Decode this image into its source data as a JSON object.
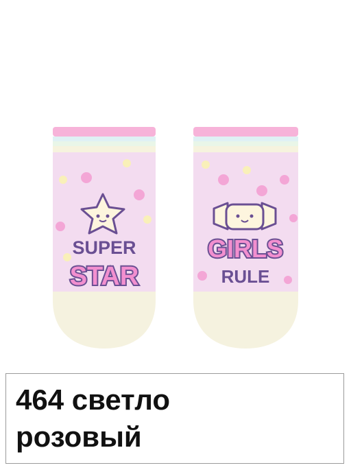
{
  "product": {
    "left_sock_text": {
      "line1": "SUPER",
      "line2": "STAR"
    },
    "right_sock_text": {
      "line1": "GIRLS",
      "line2": "RULE"
    },
    "caption": {
      "line1": "464 светло",
      "line2": "розовый"
    }
  },
  "colors": {
    "sock_body": "#f3dcf0",
    "cuff_pink": "#f7b3d9",
    "heel_toe_cream": "#f5f2df",
    "text_purple": "#6a4f93",
    "text_pink": "#f28fcf",
    "dot_pink": "#f3a6d6",
    "dot_yellow": "#f9f0b9",
    "star_cream": "#fdf5de"
  }
}
